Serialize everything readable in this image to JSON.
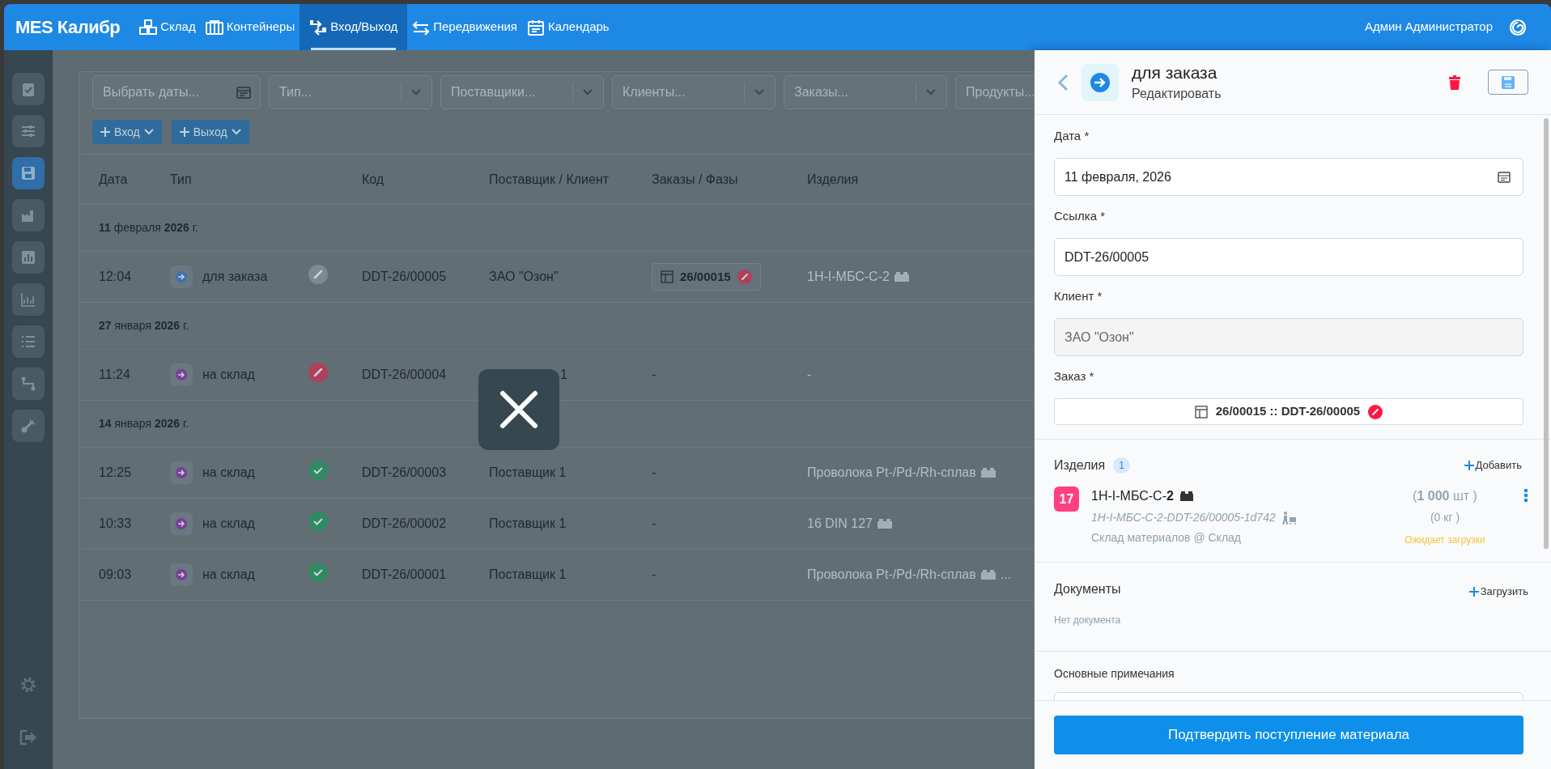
{
  "nav": {
    "brand": "MES Калибр",
    "items": [
      {
        "label": "Склад",
        "selected": false
      },
      {
        "label": "Контейнеры",
        "selected": false
      },
      {
        "label": "Вход/Выход",
        "selected": true
      },
      {
        "label": "Передвижения",
        "selected": false
      },
      {
        "label": "Календарь",
        "selected": false
      }
    ],
    "user": "Админ Администратор"
  },
  "sidebar": {
    "items": [
      {
        "selected": false
      },
      {
        "selected": false
      },
      {
        "selected": true
      },
      {
        "selected": false
      },
      {
        "selected": false
      },
      {
        "selected": false
      },
      {
        "selected": false
      },
      {
        "selected": false
      },
      {
        "selected": false
      }
    ]
  },
  "filters": [
    {
      "kind": "date",
      "placeholder": "Выбрать даты..."
    },
    {
      "kind": "select",
      "placeholder": "Тип..."
    },
    {
      "kind": "select",
      "placeholder": "Поставщики..."
    },
    {
      "kind": "select",
      "placeholder": "Клиенты..."
    },
    {
      "kind": "select",
      "placeholder": "Заказы..."
    },
    {
      "kind": "select",
      "placeholder": "Продукты..."
    }
  ],
  "add_buttons": [
    "Вход",
    "Выход"
  ],
  "table": {
    "columns": [
      "Дата",
      "Тип",
      "Код",
      "Поставщик / Клиент",
      "Заказы / Фазы",
      "Изделия"
    ],
    "groups": [
      {
        "date": "**11** февраля **2026** г.",
        "rows": [
          {
            "time": "12:04",
            "type": "для заказа",
            "color": "#3d72b0",
            "kind": "edit",
            "code": "DDT-26/00005",
            "party": "ЗАО \"Озон\"",
            "party_covered": false,
            "order": "26/00015",
            "product": "1Н-І-МБС-С-2"
          }
        ]
      },
      {
        "date": "**27** января **2026** г.",
        "rows": [
          {
            "time": "11:24",
            "type": "на склад",
            "color": "#7a3e98",
            "kind": "error",
            "code": "DDT-26/00004",
            "party": "1",
            "party_covered": true,
            "order": "-",
            "product": "-"
          }
        ]
      },
      {
        "date": "**14** января **2026** г.",
        "rows": [
          {
            "time": "12:25",
            "type": "на склад",
            "color": "#7a3e98",
            "kind": "done",
            "code": "DDT-26/00003",
            "party": "Поставщик 1",
            "party_covered": false,
            "order": "-",
            "product": "Проволока Pt-/Pd-/Rh-сплав"
          },
          {
            "time": "10:33",
            "type": "на склад",
            "color": "#7a3e98",
            "kind": "done",
            "code": "DDT-26/00002",
            "party": "Поставщик 1",
            "party_covered": false,
            "order": "-",
            "product": "16 DIN 127"
          },
          {
            "time": "09:03",
            "type": "на склад",
            "color": "#7a3e98",
            "kind": "done",
            "code": "DDT-26/00001",
            "party": "Поставщик 1",
            "party_covered": false,
            "order": "-",
            "product": "Проволока Pt-/Pd-/Rh-сплав",
            "more": "..."
          }
        ]
      }
    ]
  },
  "panel": {
    "title": "для заказа",
    "subtitle": "Редактировать",
    "fields": [
      {
        "kind": "date",
        "label": "Дата *",
        "value": "11 февраля, 2026",
        "disabled": false
      },
      {
        "kind": "text",
        "label": "Ссылка *",
        "value": "DDT-26/00005",
        "disabled": false
      },
      {
        "kind": "text",
        "label": "Клиент *",
        "value": "ЗАО \"Озон\"",
        "disabled": true
      },
      {
        "kind": "order",
        "label": "Заказ *",
        "value": "26/00015 :: DDT-26/00005",
        "disabled": false
      }
    ],
    "products": {
      "title": "Изделия",
      "count": "1",
      "add": "Добавить",
      "items": [
        {
          "badge": "17",
          "name": "1Н-І-МБС-С-**2**",
          "code": "1Н-І-МБС-С-2-DDT-26/00005-1d742",
          "location": "Склад материалов @ Склад",
          "quantity": "(**1 000** шт )",
          "weight": "(0 кг )",
          "status": "Ожидает загрузки"
        }
      ]
    },
    "documents": {
      "title": "Документы",
      "upload": "Загрузить",
      "empty": "Нет документа"
    },
    "notes": {
      "label": "Основные примечания"
    },
    "confirm": "Подтвердить поступление материала"
  }
}
